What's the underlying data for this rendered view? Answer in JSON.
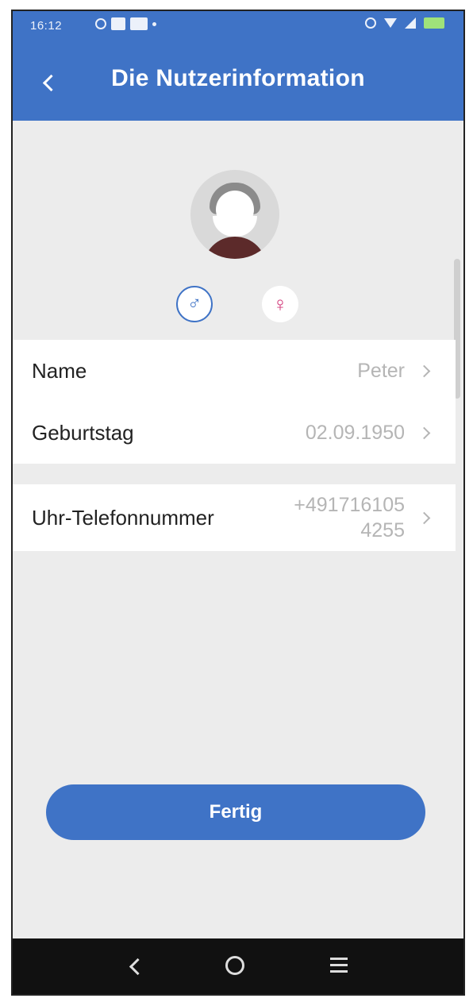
{
  "status_bar": {
    "time": "16:12"
  },
  "header": {
    "title": "Die Nutzerinformation"
  },
  "profile": {
    "male_symbol": "♂",
    "female_symbol": "♀"
  },
  "fields": [
    {
      "label": "Name",
      "value": "Peter"
    },
    {
      "label": "Geburtstag",
      "value": "02.09.1950"
    },
    {
      "label": "Uhr-Telefonnummer",
      "value_line1": "+491716105",
      "value_line2": "4255"
    }
  ],
  "actions": {
    "done_label": "Fertig"
  },
  "colors": {
    "primary": "#3f73c6",
    "female": "#d23a7a",
    "value_text": "#b5b5b5"
  }
}
